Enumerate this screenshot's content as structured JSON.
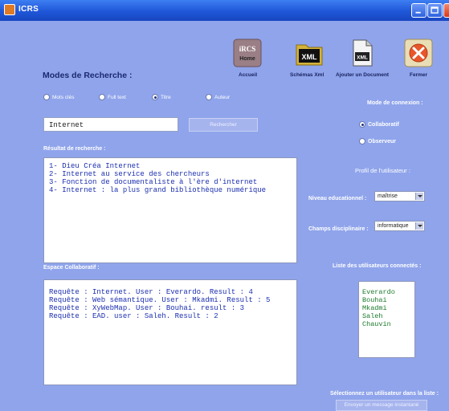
{
  "window": {
    "title": "ICRS"
  },
  "toolbar": {
    "home_logo_text": "iRCS",
    "home_logo_sub": "Home",
    "accueil_label": "Accueil",
    "xml_icon_text": "XML",
    "schemas_label": "Schémas Xml",
    "doc_icon_text": "XML",
    "add_doc_label": "Ajouter un Document",
    "close_label": "Fermer"
  },
  "search": {
    "heading": "Modes de Recherche :",
    "modes": [
      {
        "label": "Mots clés",
        "selected": false
      },
      {
        "label": "Full text",
        "selected": false
      },
      {
        "label": "Titre",
        "selected": true
      },
      {
        "label": "Auteur",
        "selected": false
      }
    ],
    "query_value": "Internet",
    "button_label": "Rechercher"
  },
  "results": {
    "label": "Résultat de recherche :",
    "items": [
      "1- Dieu Créa Internet",
      "2- Internet au service des chercheurs",
      "3- Fonction de documentaliste à l'ère d'internet",
      "4- Internet : la plus grand bibliothèque numérique"
    ]
  },
  "collab": {
    "label": "Espace Collaboratif :",
    "items": [
      "Requête : Internet. User : Everardo. Result : 4",
      "Requête : Web sémantique. User : Mkadmi. Result : 5",
      "Requête : XyWebMap. User : Bouhai. result : 3",
      "Requête : EAD. user : Saleh. Result : 2"
    ]
  },
  "connection": {
    "label": "Mode de connexion :",
    "options": [
      {
        "label": "Collaboratif",
        "selected": true
      },
      {
        "label": "Observeur",
        "selected": false
      }
    ]
  },
  "profile": {
    "label": "Profil de l'utilisateur :",
    "education_label": "Niveau educationnel :",
    "education_value": "maîtrise",
    "field_label": "Champs disciplinaire :",
    "field_value": "informatique"
  },
  "users": {
    "label": "Liste des utilisateurs connectés :",
    "items": [
      "Everardo",
      "Bouhai",
      "Mkadmi",
      "Saleh",
      "Chauvin"
    ],
    "select_hint": "Sélectionnez un utilisateur dans la liste :",
    "send_button": "Envoyer un message instantané"
  },
  "colors": {
    "background": "#8fa4eb",
    "titlebar": "#1f56d8",
    "text_blue": "#1c2fb0",
    "user_green": "#1a7a2a"
  }
}
